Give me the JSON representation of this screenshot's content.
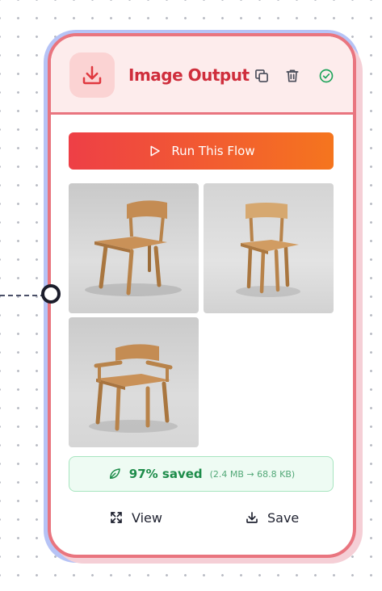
{
  "node": {
    "title": "Image Output",
    "icons": {
      "header": "download-icon",
      "copy": "copy-icon",
      "delete": "trash-icon",
      "status": "check-circle-icon"
    },
    "colors": {
      "accent": "#cf2e3c",
      "border": "#e9757f",
      "header_bg": "#fdecec",
      "gradient_start": "#ee3f46",
      "gradient_end": "#f5751e",
      "success": "#1d8c4a",
      "status_icon": "#1fa45b"
    }
  },
  "run_button": {
    "label": "Run This Flow",
    "icon": "play-icon"
  },
  "images": [
    {
      "name": "chair-thumbnail-1",
      "subject": "side chair angled view"
    },
    {
      "name": "chair-thumbnail-2",
      "subject": "side chair front view"
    },
    {
      "name": "chair-thumbnail-3",
      "subject": "armchair angled view"
    }
  ],
  "savings": {
    "label": "97% saved",
    "detail": "(2.4 MB → 68.8 KB)",
    "icon": "leaf-icon"
  },
  "actions": {
    "view_label": "View",
    "view_icon": "expand-icon",
    "save_label": "Save",
    "save_icon": "download-icon"
  }
}
